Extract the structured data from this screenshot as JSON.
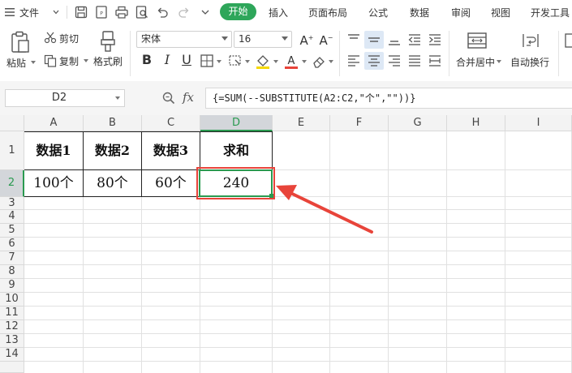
{
  "menu": {
    "file": "文件",
    "active_tab": "开始",
    "tabs": [
      "插入",
      "页面布局",
      "公式",
      "数据",
      "审阅",
      "视图",
      "开发工具"
    ]
  },
  "ribbon": {
    "paste": "粘贴",
    "cut": "剪切",
    "copy": "复制",
    "format_painter": "格式刷",
    "font_name": "宋体",
    "font_size": "16",
    "merge_center": "合并居中",
    "wrap_text": "自动换行"
  },
  "formula_bar": {
    "name_box": "D2",
    "fx": "fx",
    "formula": "{=SUM(--SUBSTITUTE(A2:C2,\"个\",\"\"))}"
  },
  "grid": {
    "columns": [
      "A",
      "B",
      "C",
      "D",
      "E",
      "F",
      "G",
      "H",
      "I"
    ],
    "rows": [
      "1",
      "2",
      "3",
      "4",
      "5",
      "6",
      "7",
      "8",
      "9",
      "10",
      "11",
      "12",
      "13",
      "14"
    ],
    "selected_cell": "D2",
    "cells": {
      "A1": "数据1",
      "B1": "数据2",
      "C1": "数据3",
      "D1": "求和",
      "A2": "100个",
      "B2": "80个",
      "C2": "60个",
      "D2": "240"
    }
  },
  "colors": {
    "accent_green": "#2ea65a",
    "selection_green": "#2a9a50",
    "highlight_red": "#e8443a"
  }
}
